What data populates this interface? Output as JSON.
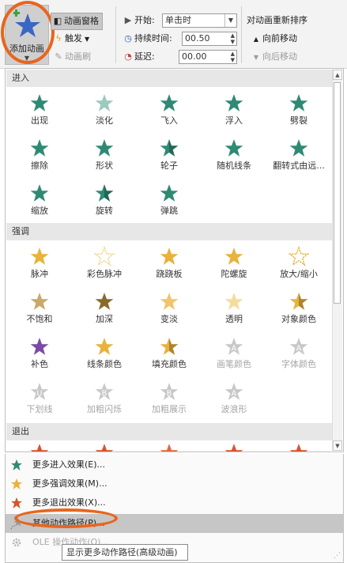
{
  "ribbon": {
    "add_animation": "添加动画",
    "animation_pane": "动画窗格",
    "trigger": "触发",
    "animation_painter": "动画刷",
    "start_label": "开始:",
    "start_value": "单击时",
    "duration_label": "持续时间:",
    "duration_value": "00.50",
    "delay_label": "延迟:",
    "delay_value": "00.00",
    "reorder_title": "对动画重新排序",
    "move_earlier": "向前移动",
    "move_later": "向后移动"
  },
  "sections": {
    "entrance": "进入",
    "emphasis": "强调",
    "exit": "退出"
  },
  "entrance_effects": [
    "出现",
    "淡化",
    "飞入",
    "浮入",
    "劈裂",
    "擦除",
    "形状",
    "轮子",
    "随机线条",
    "翻转式由远...",
    "缩放",
    "旋转",
    "弹跳"
  ],
  "emphasis_effects": [
    "脉冲",
    "彩色脉冲",
    "跷跷板",
    "陀螺旋",
    "放大/缩小",
    "不饱和",
    "加深",
    "变淡",
    "透明",
    "对象颜色",
    "补色",
    "线条颜色",
    "填充颜色",
    "画笔颜色",
    "字体颜色",
    "下划线",
    "加粗闪烁",
    "加粗展示",
    "波浪形"
  ],
  "menu": {
    "more_entrance": "更多进入效果(E)...",
    "more_emphasis": "更多强调效果(M)...",
    "more_exit": "更多退出效果(X)...",
    "more_paths": "其他动作路径(P)...",
    "ole": "OLE 操作动作(O)...",
    "tooltip": "显示更多动作路径(高级动画)"
  },
  "colors": {
    "entrance_star": "#2f8a74",
    "emphasis_star": "#e8b23c",
    "exit_star": "#d9532b",
    "highlight_circle": "#e8651e",
    "add_star": "#3a66c4"
  }
}
